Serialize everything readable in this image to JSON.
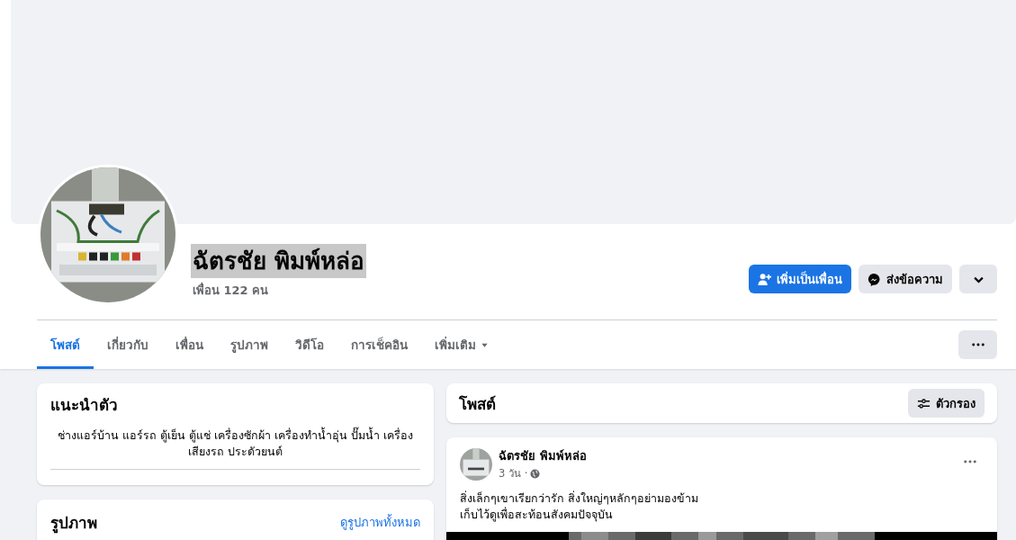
{
  "profile": {
    "name": "ฉัตรชัย พิมพ์หล่อ",
    "name_highlighted": true,
    "friends": "เพื่อน 122 คน"
  },
  "actions": [
    {
      "kind": "add",
      "label": "เพิ่มเป็นเพื่อน"
    },
    {
      "kind": "message",
      "label": "ส่งข้อความ"
    },
    {
      "kind": "dropdown"
    }
  ],
  "tabs": [
    {
      "label": "โพสต์",
      "selected": true,
      "dropdown": false
    },
    {
      "label": "เกี่ยวกับ",
      "selected": false,
      "dropdown": false
    },
    {
      "label": "เพื่อน",
      "selected": false,
      "dropdown": false
    },
    {
      "label": "รูปภาพ",
      "selected": false,
      "dropdown": false
    },
    {
      "label": "วิดีโอ",
      "selected": false,
      "dropdown": false
    },
    {
      "label": "การเช็คอิน",
      "selected": false,
      "dropdown": false
    },
    {
      "label": "เพิ่มเติม",
      "selected": false,
      "dropdown": true
    }
  ],
  "intro": {
    "title": "แนะนำตัว",
    "bio": "ช่างแอร์บ้าน แอร์รถ ตู้เย็น ตู้แช่ เครื่องซักผ้า เครื่องทำน้ำอุ่น ปั๊มน้ำ เครื่องเสียงรถ ประดัวยนต์"
  },
  "photos": {
    "title": "รูปภาพ",
    "link": "ดูรูปภาพทั้งหมด"
  },
  "posts_header": {
    "title": "โพสต์",
    "filter": "ตัวกรอง"
  },
  "post": {
    "author": "ฉัตรชัย พิมพ์หล่อ",
    "time": "3 วัน ·",
    "text": "สิ่งเล็กๆเขาเรียกว่ารัก  สิ่งใหญ่ๆหลักๆอย่ามองข้าม\nเก็บไว้ดูเพื่อสะท้อนสังคมปัจจุบัน"
  }
}
